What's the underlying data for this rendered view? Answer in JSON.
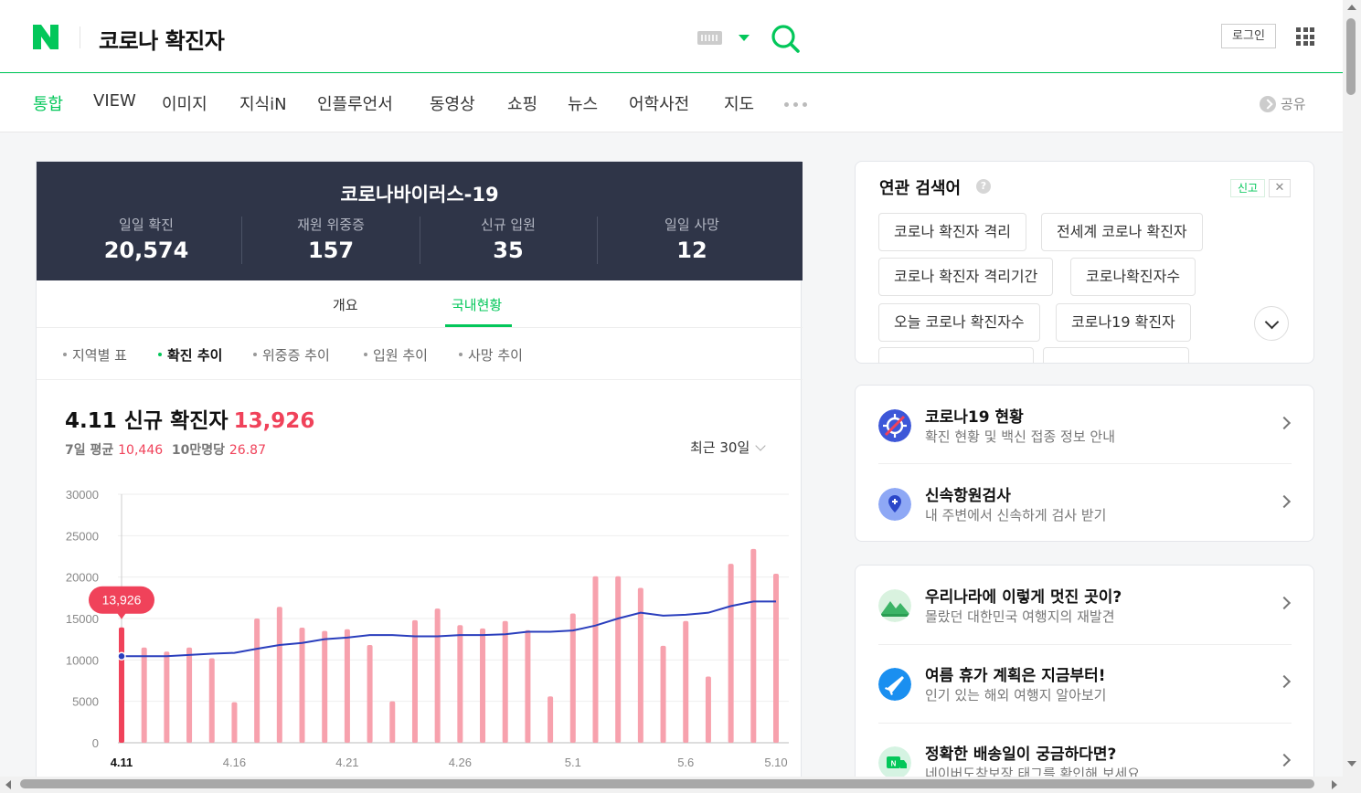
{
  "header": {
    "query": "코로나 확진자",
    "login_label": "로그인",
    "logo_letter": "N"
  },
  "tabs": [
    "통합",
    "VIEW",
    "이미지",
    "지식iN",
    "인플루언서",
    "동영상",
    "쇼핑",
    "뉴스",
    "어학사전",
    "지도"
  ],
  "share_label": "공유",
  "covid": {
    "title": "코로나바이러스-19",
    "stats": [
      {
        "label": "일일 확진",
        "value": "20,574"
      },
      {
        "label": "재원 위중증",
        "value": "157"
      },
      {
        "label": "신규 입원",
        "value": "35"
      },
      {
        "label": "일일 사망",
        "value": "12"
      }
    ],
    "subtabs": [
      "개요",
      "국내현황"
    ],
    "filters": [
      "지역별 표",
      "확진 추이",
      "위중증 추이",
      "입원 추이",
      "사망 추이"
    ],
    "chart_title": "4.11 신규 확진자",
    "chart_title_value": "13,926",
    "avg_label": "7일 평균",
    "avg_value": "10,446",
    "per100k_label": "10만명당",
    "per100k_value": "26.87",
    "range_label": "최근 30일"
  },
  "chart_data": {
    "type": "bar",
    "title": "4.11 신규 확진자",
    "categories": [
      "4.11",
      "4.12",
      "4.13",
      "4.14",
      "4.15",
      "4.16",
      "4.17",
      "4.18",
      "4.19",
      "4.20",
      "4.21",
      "4.22",
      "4.23",
      "4.24",
      "4.25",
      "4.26",
      "4.27",
      "4.28",
      "4.29",
      "4.30",
      "5.1",
      "5.2",
      "5.3",
      "5.4",
      "5.5",
      "5.6",
      "5.7",
      "5.8",
      "5.9",
      "5.10"
    ],
    "x_tick_labels": [
      "4.11",
      "4.16",
      "4.21",
      "4.26",
      "5.1",
      "5.6",
      "5.10"
    ],
    "series": [
      {
        "type": "bar",
        "values": [
          13926,
          11500,
          11000,
          11500,
          10200,
          4900,
          15000,
          16400,
          13900,
          13500,
          13700,
          11800,
          5000,
          14800,
          16200,
          14200,
          13800,
          14700,
          13600,
          5600,
          15600,
          20100,
          20100,
          18700,
          11700,
          14700,
          8000,
          21600,
          23400,
          20400
        ]
      },
      {
        "type": "line",
        "values": [
          10446,
          10450,
          10450,
          10600,
          10750,
          10850,
          11350,
          11800,
          12050,
          12500,
          12700,
          13000,
          13000,
          12850,
          12850,
          13000,
          13000,
          13100,
          13400,
          13400,
          13550,
          14150,
          15000,
          15700,
          15350,
          15450,
          15700,
          16500,
          17050,
          17050
        ]
      }
    ],
    "ylim": [
      0,
      30000
    ],
    "yticks": [
      0,
      5000,
      10000,
      15000,
      20000,
      25000,
      30000
    ],
    "tooltip": "13,926",
    "colors": {
      "bar": "#f7a1ad",
      "bar_selected": "#f0425a",
      "line": "#2a3ebd",
      "tooltip": "#f0425a"
    }
  },
  "related": {
    "title": "연관 검색어",
    "help": "?",
    "report_label": "신고",
    "close_label": "✕",
    "chips": [
      "코로나 확진자 격리",
      "전세계 코로나 확진자",
      "코로나 확진자 격리기간",
      "코로나확진자수",
      "오늘 코로나 확진자수",
      "코로나19 확진자"
    ]
  },
  "links_card1": [
    {
      "title": "코로나19 현황",
      "desc": "확진 현황 및 백신 접종 정보 안내",
      "icon": "virus-icon"
    },
    {
      "title": "신속항원검사",
      "desc": "내 주변에서 신속하게 검사 받기",
      "icon": "location-pin-icon"
    }
  ],
  "links_card2": [
    {
      "title": "우리나라에 이렇게 멋진 곳이?",
      "desc": "몰랐던 대한민국 여행지의 재발견",
      "icon": "mountain-icon"
    },
    {
      "title": "여름 휴가 계획은 지금부터!",
      "desc": "인기 있는 해외 여행지 알아보기",
      "icon": "airplane-icon"
    },
    {
      "title": "정확한 배송일이 궁금하다면?",
      "desc": "네이버도착보장 태그를 확인해 보세요",
      "icon": "delivery-truck-icon"
    }
  ]
}
